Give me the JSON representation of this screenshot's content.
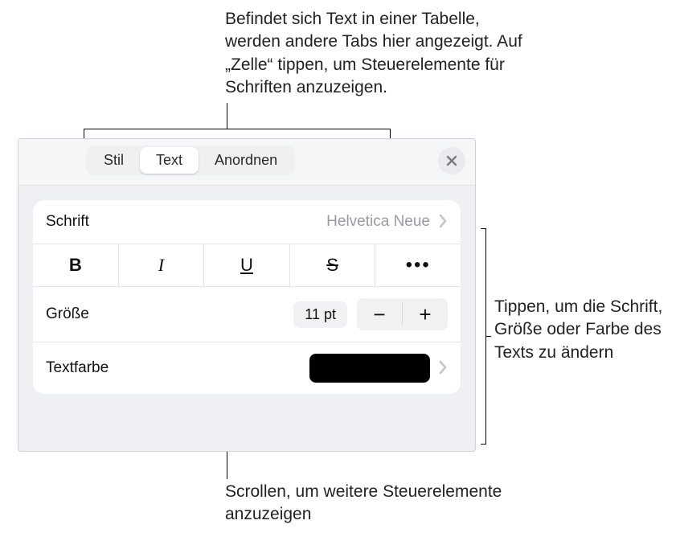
{
  "callouts": {
    "top": "Befindet sich Text in einer Tabelle, werden andere Tabs hier angezeigt. Auf „Zelle“ tippen, um Steuerelemente für Schriften anzuzeigen.",
    "right": "Tippen, um die Schrift, Größe oder Farbe des Texts zu ändern",
    "bottom": "Scrollen, um weitere Steuerelemente anzuzeigen"
  },
  "tabs": {
    "stil": "Stil",
    "text": "Text",
    "anordnen": "Anordnen",
    "active": "text"
  },
  "font": {
    "label": "Schrift",
    "value": "Helvetica Neue"
  },
  "styleButtons": {
    "bold": "B",
    "italic": "I",
    "underline": "U",
    "strike": "S"
  },
  "size": {
    "label": "Größe",
    "value": "11 pt",
    "minus": "−",
    "plus": "+"
  },
  "textcolor": {
    "label": "Textfarbe",
    "swatch": "#000000"
  }
}
